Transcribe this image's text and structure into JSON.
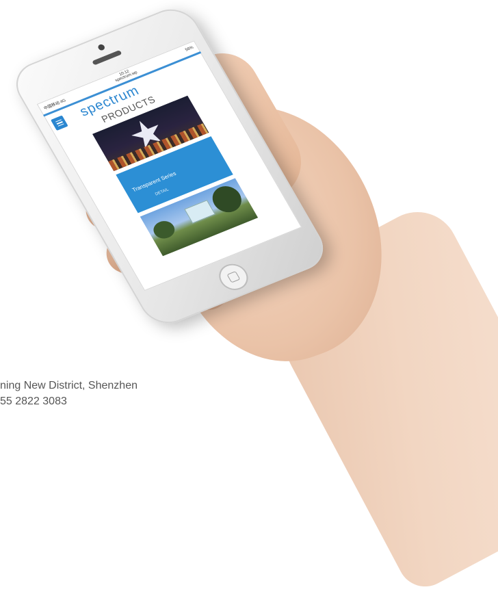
{
  "phone_screen": {
    "status_left": "中国移动 4G",
    "status_time": "10:12",
    "status_url": "spectrum.wp",
    "status_right": "56%",
    "logo_text": "spectrum",
    "page_title": "PRODUCTS",
    "card_title": "Transparent Series",
    "card_link": "DETAIL"
  },
  "footer": {
    "address_line": "ning New District, Shenzhen",
    "phone_line": "55 2822 3083"
  },
  "colors": {
    "accent_blue": "#2c8fd5",
    "text_gray": "#555555"
  },
  "icons": [
    "menu-icon",
    "home-button-icon"
  ]
}
